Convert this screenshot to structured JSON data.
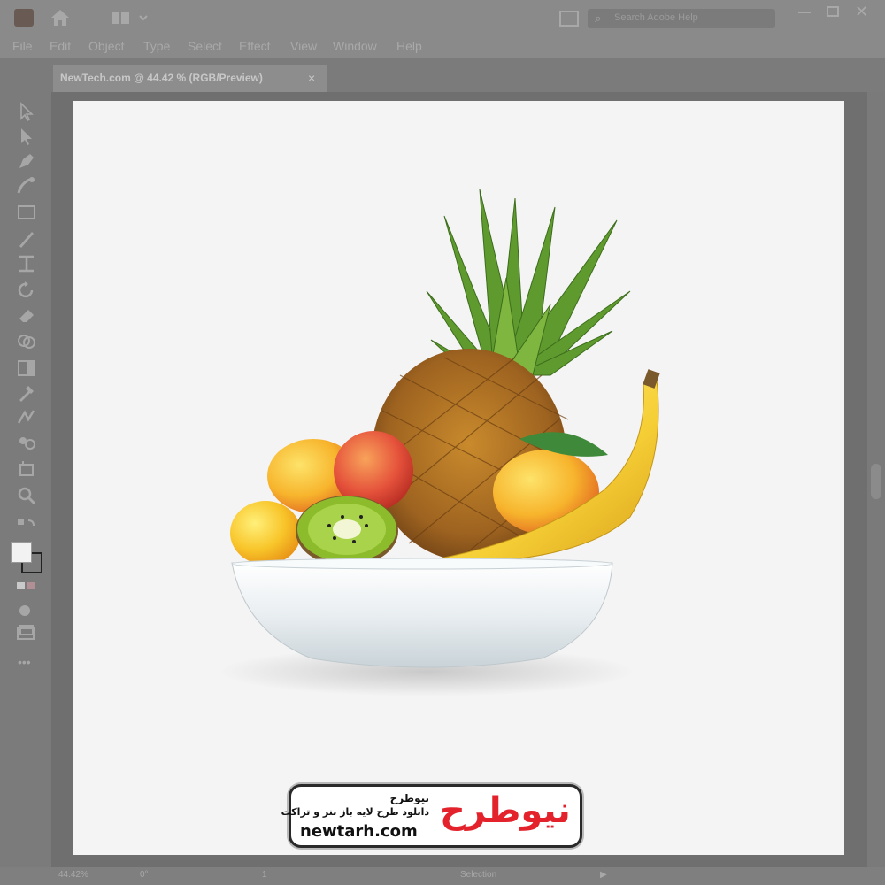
{
  "window": {
    "app_icon": "illustrator-logo-icon",
    "home_icon": "home-icon",
    "workspace_icon": "workspace-switcher-icon",
    "search_placeholder": "Search Adobe Help",
    "controls": [
      "minimize-icon",
      "maximize-icon",
      "close-icon"
    ]
  },
  "menu": [
    "File",
    "Edit",
    "Object",
    "Type",
    "Select",
    "Effect",
    "View",
    "Window",
    "Help"
  ],
  "document_tab": {
    "label": "NewTech.com @ 44.42 % (RGB/Preview)",
    "close": "×"
  },
  "tools": [
    "selection-tool-icon",
    "direct-selection-tool-icon",
    "pen-tool-icon",
    "curvature-tool-icon",
    "rectangle-tool-icon",
    "paintbrush-tool-icon",
    "type-tool-icon",
    "rotate-tool-icon",
    "eraser-tool-icon",
    "shape-builder-tool-icon",
    "gradient-tool-icon",
    "eyedropper-tool-icon",
    "blend-tool-icon",
    "symbol-sprayer-tool-icon",
    "artboard-tool-icon",
    "zoom-tool-icon",
    "swap-colors-icon",
    "fill-stroke-swatch",
    "color-mode-icon",
    "drawing-mode-icon",
    "screen-mode-icon",
    "more-tools-icon"
  ],
  "statusbar": {
    "zoom": "44.42%",
    "rotation": "0°",
    "artboard_number": "1",
    "tool": "Selection"
  },
  "watermark": {
    "brand_fa": "نیوطرح",
    "tagline_fa": "دانلود طرح لایه باز بنر و تراکت",
    "url": "newtarh.com",
    "logo_fa": "نیوطرح"
  },
  "colors": {
    "ui_gray": "#8a8a8a",
    "artboard": "#f4f4f4",
    "brand_red": "#e3222c"
  }
}
